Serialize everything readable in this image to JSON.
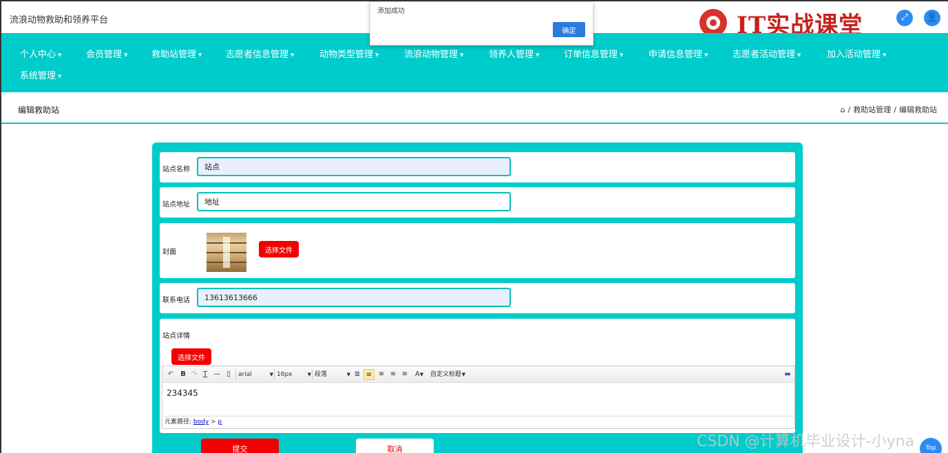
{
  "header": {
    "app_title": "流浪动物救助和领养平台",
    "brand_text": "IT实战课堂"
  },
  "alert": {
    "message": "添加成功",
    "confirm_label": "确定"
  },
  "nav": {
    "items": [
      "个人中心",
      "会员管理",
      "救助站管理",
      "志愿者信息管理",
      "动物类型管理",
      "流浪动物管理",
      "领养人管理",
      "订单信息管理",
      "申请信息管理",
      "志愿者活动管理",
      "加入活动管理",
      "系统管理"
    ]
  },
  "breadcrumb": {
    "page_title": "编辑救助站",
    "path": [
      "救助站管理",
      "编辑救助站"
    ]
  },
  "form": {
    "name_label": "站点名称",
    "name_value": "站点",
    "address_label": "站点地址",
    "address_value": "地址",
    "cover_label": "封面",
    "cover_button": "选择文件",
    "phone_label": "联系电话",
    "phone_value": "13613613666",
    "detail_label": "站点详情",
    "detail_button": "选择文件",
    "submit_label": "提交",
    "cancel_label": "取消"
  },
  "editor": {
    "font_family": "arial",
    "font_size": "16px",
    "paragraph": "段落",
    "custom_title": "自定义标题",
    "content": "234345",
    "path_label": "元素路径:",
    "path_body": "body",
    "path_sep": ">",
    "path_p": "p"
  },
  "footer": {
    "top_label": "Top",
    "watermark": "CSDN @计算机毕业设计-小yna"
  }
}
